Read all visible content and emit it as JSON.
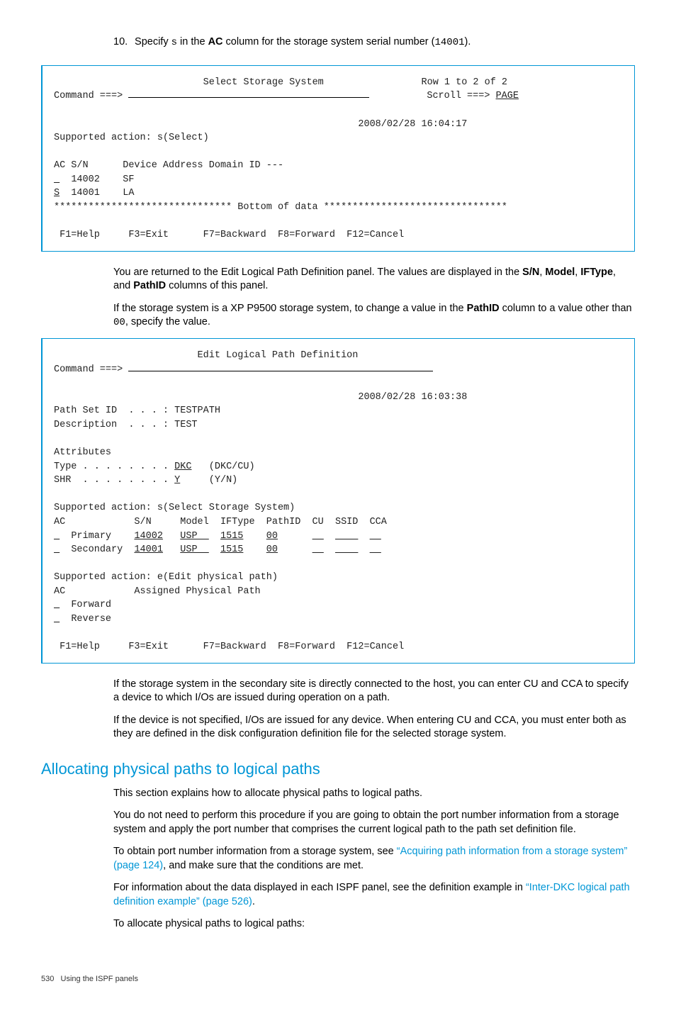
{
  "step10": {
    "num": "10.",
    "prefix": "Specify ",
    "code1": "s",
    "mid1": " in the ",
    "bold1": "AC",
    "mid2": " column for the storage system serial number (",
    "code2": "14001",
    "end": ")."
  },
  "term1": {
    "title": "Select Storage System",
    "rowinfo": "Row 1 to 2 of 2",
    "cmd": "Command ===>",
    "scroll_lbl": "Scroll ===> ",
    "scroll_val": "PAGE",
    "timestamp": "2008/02/28 16:04:17",
    "supported": "Supported action: s(Select)",
    "hdr": "AC S/N      Device Address Domain ID ---",
    "r1_ac": "_",
    "r1_sn": "14002",
    "r1_dev": "SF",
    "r2_ac": "S",
    "r2_sn": "14001",
    "r2_dev": "LA",
    "bottom": "******************************* Bottom of data ********************************",
    "fkeys": " F1=Help     F3=Exit      F7=Backward  F8=Forward  F12=Cancel"
  },
  "p1": {
    "t1": "You are returned to the Edit Logical Path Definition panel. The values are displayed in the ",
    "b1": "S/N",
    "c1": ", ",
    "b2": "Model",
    "c2": ", ",
    "b3": "IFType",
    "c3": ", and ",
    "b4": "PathID",
    "t2": " columns of this panel."
  },
  "p2": {
    "t1": "If the storage system is a XP P9500 storage system, to change a value in the ",
    "b1": "PathID",
    "t2": " column to a value other than ",
    "code": "00",
    "t3": ", specify the value."
  },
  "term2": {
    "title": "Edit Logical Path Definition",
    "cmd": "Command ===>",
    "timestamp": "2008/02/28 16:03:38",
    "pathset": "Path Set ID  . . . : TESTPATH",
    "desc": "Description  . . . : TEST",
    "attrs": "Attributes",
    "type_lbl": "Type . . . . . . . . ",
    "type_val": "DKC",
    "type_opts": "(DKC/CU)",
    "shr_lbl": "SHR  . . . . . . . . ",
    "shr_val": "Y",
    "shr_opts": "(Y/N)",
    "sup1": "Supported action: s(Select Storage System)",
    "hdr1": "AC            S/N     Model  IFType  PathID  CU  SSID  CCA",
    "r1_ac": "_",
    "r1_role": "Primary  ",
    "r1_sn": "14002",
    "r1_model": "USP  ",
    "r1_if": "1515",
    "r1_p": "00",
    "r2_ac": "_",
    "r2_role": "Secondary",
    "r2_sn": "14001",
    "r2_model": "USP  ",
    "r2_if": "1515",
    "r2_p": "00",
    "sup2": "Supported action: e(Edit physical path)",
    "hdr2": "AC            Assigned Physical Path",
    "fwd_ac": "_",
    "fwd": "Forward",
    "rev_ac": "_",
    "rev": "Reverse",
    "fkeys": " F1=Help     F3=Exit      F7=Backward  F8=Forward  F12=Cancel"
  },
  "p3": "If the storage system in the secondary site is directly connected to the host, you can enter CU and CCA to specify a device to which I/Os are issued during operation on a path.",
  "p4": "If the device is not specified, I/Os are issued for any device. When entering CU and CCA, you must enter both as they are defined in the disk configuration definition file for the selected storage system.",
  "heading": "Allocating physical paths to logical paths",
  "p5": "This section explains how to allocate physical paths to logical paths.",
  "p6": "You do not need to perform this procedure if you are going to obtain the port number information from a storage system and apply the port number that comprises the current logical path to the path set definition file.",
  "p7": {
    "t1": "To obtain port number information from a storage system, see ",
    "link": "“Acquiring path information from a storage system” (page 124)",
    "t2": ", and make sure that the conditions are met."
  },
  "p8": {
    "t1": "For information about the data displayed in each ISPF panel, see the definition example in ",
    "link": "“Inter-DKC logical path definition example” (page 526)",
    "t2": "."
  },
  "p9": "To allocate physical paths to logical paths:",
  "footer": {
    "page": "530",
    "title": "Using the ISPF panels"
  }
}
